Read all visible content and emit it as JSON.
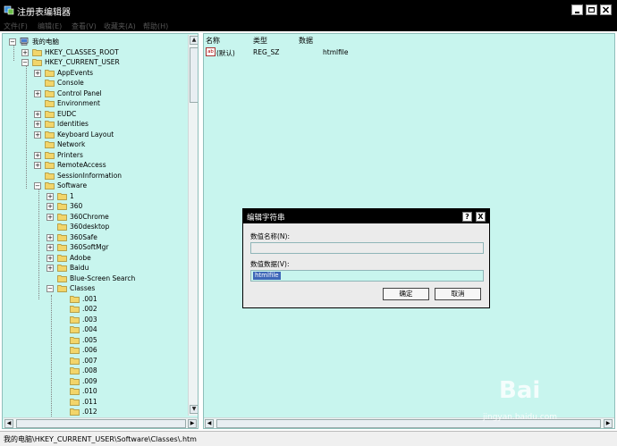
{
  "window": {
    "title": "注册表编辑器"
  },
  "menu": [
    "文件(F)",
    "编辑(E)",
    "查看(V)",
    "收藏夹(A)",
    "帮助(H)"
  ],
  "tree": {
    "root": "我的电脑",
    "hives": [
      "HKEY_CLASSES_ROOT",
      "HKEY_CURRENT_USER"
    ],
    "hkcu_children": [
      "AppEvents",
      "Console",
      "Control Panel",
      "Environment",
      "EUDC",
      "Identities",
      "Keyboard Layout",
      "Network",
      "Printers",
      "RemoteAccess",
      "SessionInformation",
      "Software"
    ],
    "software_children": [
      "1",
      "360",
      "360Chrome",
      "360desktop",
      "360Safe",
      "360SoftMgr",
      "Adobe",
      "Baidu",
      "Blue-Screen Search",
      "Classes"
    ],
    "classes_children": [
      ".001",
      ".002",
      ".003",
      ".004",
      ".005",
      ".006",
      ".007",
      ".008",
      ".009",
      ".010",
      ".011",
      ".012"
    ]
  },
  "list": {
    "columns": [
      "名称",
      "类型",
      "数据"
    ],
    "rows": [
      {
        "name": "(默认)",
        "type": "REG_SZ",
        "data": "htmlfile",
        "icon": "ab"
      }
    ]
  },
  "dialog": {
    "title": "编辑字符串",
    "name_label": "数值名称(N):",
    "name_value": "",
    "data_label": "数值数据(V):",
    "data_value": "htmlfile",
    "ok": "确定",
    "cancel": "取消",
    "help_glyph": "?",
    "close_glyph": "X"
  },
  "status": "我的电脑\\HKEY_CURRENT_USER\\Software\\Classes\\.htm",
  "watermark": {
    "top": "Bai",
    "bottom": "jingyan.baidu.com"
  }
}
